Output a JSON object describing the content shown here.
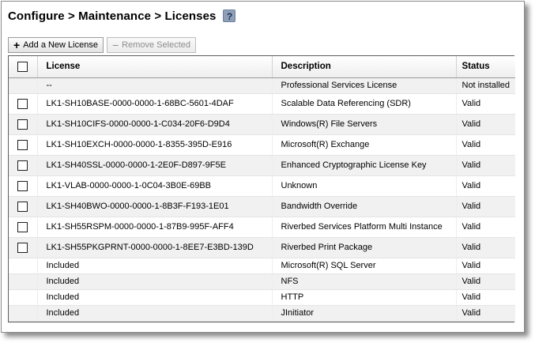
{
  "header": {
    "title": "Configure > Maintenance > Licenses",
    "help_label": "?"
  },
  "toolbar": {
    "add_label": "Add a New License",
    "remove_label": "Remove Selected"
  },
  "table": {
    "columns": [
      "License",
      "Description",
      "Status"
    ],
    "rows": [
      {
        "license": "--",
        "description": "Professional Services License",
        "status": "Not installed"
      },
      {
        "license": "LK1-SH10BASE-0000-0000-1-68BC-5601-4DAF",
        "description": "Scalable Data Referencing (SDR)",
        "status": "Valid"
      },
      {
        "license": "LK1-SH10CIFS-0000-0000-1-C034-20F6-D9D4",
        "description": "Windows(R) File Servers",
        "status": "Valid"
      },
      {
        "license": "LK1-SH10EXCH-0000-0000-1-8355-395D-E916",
        "description": "Microsoft(R) Exchange",
        "status": "Valid"
      },
      {
        "license": "LK1-SH40SSL-0000-0000-1-2E0F-D897-9F5E",
        "description": "Enhanced Cryptographic License Key",
        "status": "Valid"
      },
      {
        "license": "LK1-VLAB-0000-0000-1-0C04-3B0E-69BB",
        "description": "Unknown",
        "status": "Valid"
      },
      {
        "license": "LK1-SH40BWO-0000-0000-1-8B3F-F193-1E01",
        "description": "Bandwidth Override",
        "status": "Valid"
      },
      {
        "license": "LK1-SH55RSPM-0000-0000-1-87B9-995F-AFF4",
        "description": "Riverbed Services Platform Multi Instance",
        "status": "Valid"
      },
      {
        "license": "LK1-SH55PKGPRNT-0000-0000-1-8EE7-E3BD-139D",
        "description": "Riverbed Print Package",
        "status": "Valid"
      },
      {
        "license": "Included",
        "description": "Microsoft(R) SQL Server",
        "status": "Valid"
      },
      {
        "license": "Included",
        "description": "NFS",
        "status": "Valid"
      },
      {
        "license": "Included",
        "description": "HTTP",
        "status": "Valid"
      },
      {
        "license": "Included",
        "description": "JInitiator",
        "status": "Valid"
      }
    ]
  }
}
